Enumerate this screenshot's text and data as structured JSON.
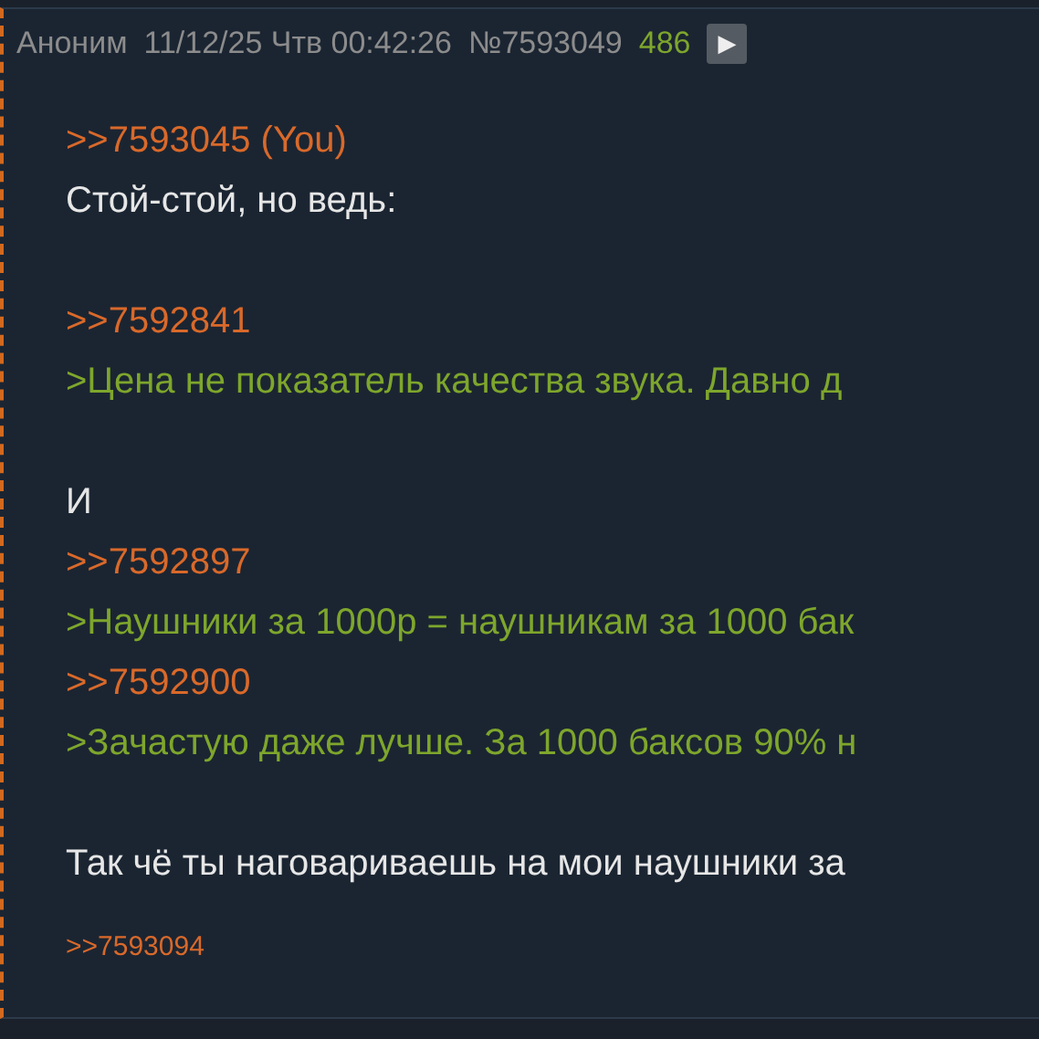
{
  "post": {
    "author": "Аноним",
    "date": "11/12/25 Чтв 00:42:26",
    "number": "№7593049",
    "count": "486",
    "play_button": "▶",
    "paragraphs": [
      [
        {
          "kind": "link",
          "text": ">>7593045 (You)"
        },
        {
          "kind": "text",
          "text": "Стой-стой, но ведь:"
        }
      ],
      [
        {
          "kind": "link",
          "text": ">>7592841"
        },
        {
          "kind": "quote",
          "text": ">Цена не показатель качества звука. Давно д"
        }
      ],
      [
        {
          "kind": "text",
          "text": "И"
        },
        {
          "kind": "link",
          "text": ">>7592897"
        },
        {
          "kind": "quote",
          "text": ">Наушники за 1000р = наушникам за 1000 бак"
        },
        {
          "kind": "link",
          "text": ">>7592900"
        },
        {
          "kind": "quote",
          "text": ">Зачастую даже лучше. За 1000 баксов 90% н"
        }
      ],
      [
        {
          "kind": "text",
          "text": "Так чё ты наговариваешь на мои наушники за"
        }
      ]
    ],
    "replies": [
      ">>7593094"
    ]
  }
}
